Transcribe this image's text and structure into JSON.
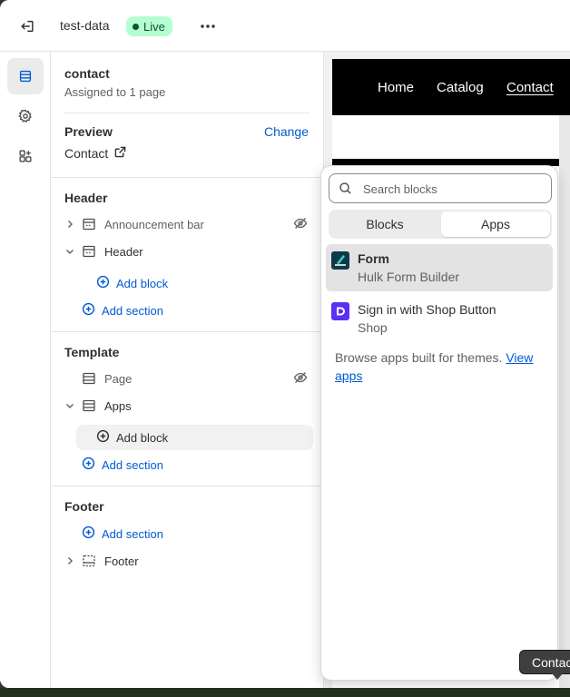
{
  "topbar": {
    "store_name": "test-data",
    "live_badge": "Live"
  },
  "page": {
    "title": "contact",
    "assigned": "Assigned to 1 page"
  },
  "preview": {
    "label": "Preview",
    "change": "Change",
    "value": "Contact"
  },
  "header_group": {
    "title": "Header",
    "announcement_bar": "Announcement bar",
    "header": "Header",
    "add_block": "Add block",
    "add_section": "Add section"
  },
  "template_group": {
    "title": "Template",
    "page": "Page",
    "apps": "Apps",
    "add_block": "Add block",
    "add_section": "Add section"
  },
  "footer_group": {
    "title": "Footer",
    "add_section": "Add section",
    "footer": "Footer"
  },
  "site": {
    "nav": [
      "Home",
      "Catalog",
      "Contact"
    ]
  },
  "picker": {
    "search_placeholder": "Search blocks",
    "tabs": [
      "Blocks",
      "Apps"
    ],
    "apps": [
      {
        "name": "Form",
        "vendor": "Hulk Form Builder",
        "logo_color": "#0f3a4a"
      },
      {
        "name": "Sign in with Shop Button",
        "vendor": "Shop",
        "logo_color": "#5a31f4"
      }
    ],
    "browse_text": "Browse apps built for themes.",
    "browse_link": "View apps"
  },
  "tooltip": "Contact",
  "colors": {
    "accent": "#005bd3",
    "live_bg": "#b4fed2",
    "live_fg": "#0c5132"
  }
}
